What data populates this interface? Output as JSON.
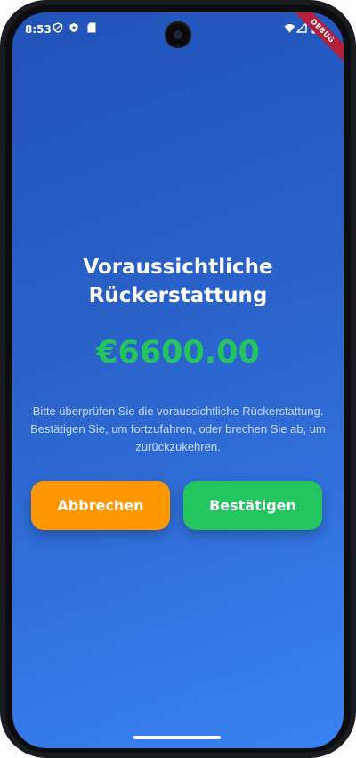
{
  "status_bar": {
    "time": "8:53",
    "left_icons": [
      "shield-outline-icon",
      "shield-icon",
      "sim-card-icon"
    ],
    "right_icons": [
      "wifi-icon",
      "signal-icon",
      "battery-icon"
    ]
  },
  "debug_banner": "DEBUG",
  "refund": {
    "title_line1": "Voraussichtliche",
    "title_line2": "Rückerstattung",
    "amount": "€6600.00",
    "description": "Bitte überprüfen Sie die voraussichtliche Rückerstattung. Bestätigen Sie, um fortzufahren, oder brechen Sie ab, um zurückzukehren."
  },
  "actions": {
    "cancel_label": "Abbrechen",
    "confirm_label": "Bestätigen"
  },
  "colors": {
    "background_start": "#2153b8",
    "background_end": "#3a82f2",
    "amount": "#22c55e",
    "cancel": "#ff9800",
    "confirm": "#22c55e"
  }
}
